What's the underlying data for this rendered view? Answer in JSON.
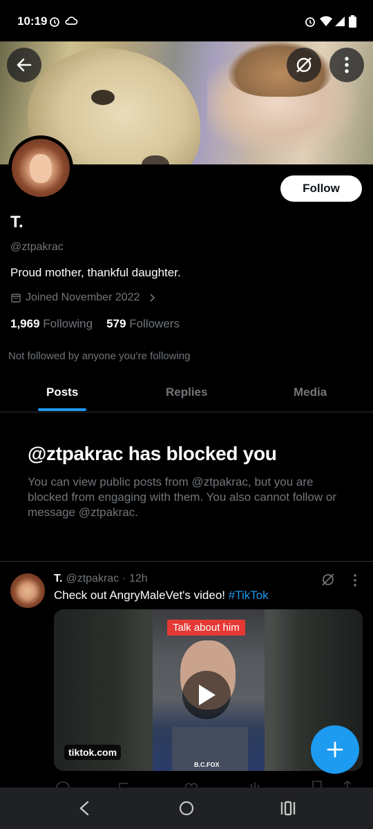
{
  "status_bar": {
    "time": "10:19",
    "icons": [
      "alarm-icon",
      "cloud-icon",
      "alarm-icon",
      "wifi-icon",
      "signal-icon",
      "battery-icon"
    ]
  },
  "header": {
    "back_icon": "arrow-left-icon",
    "grok_icon": "grok-icon",
    "more_icon": "more-vertical-icon"
  },
  "profile": {
    "follow_label": "Follow",
    "name": "T.",
    "handle": "@ztpakrac",
    "bio": "Proud mother, thankful daughter.",
    "joined": "Joined November 2022",
    "following_count": "1,969",
    "following_label": "Following",
    "followers_count": "579",
    "followers_label": "Followers",
    "not_followed": "Not followed by anyone you’re following"
  },
  "tabs": [
    {
      "label": "Posts",
      "active": true
    },
    {
      "label": "Replies",
      "active": false
    },
    {
      "label": "Media",
      "active": false
    }
  ],
  "blocked": {
    "title": "@ztpakrac has blocked you",
    "text": "You can view public posts from @ztpakrac, but you are blocked from engaging with them. You also cannot follow or message @ztpakrac."
  },
  "post": {
    "name": "T.",
    "handle": "@ztpakrac",
    "time": "· 12h",
    "text": "Check out AngryMaleVet's video!",
    "hashtag": "#TikTok",
    "card": {
      "overlay_label": "Talk about him",
      "domain": "tiktok.com",
      "watermark": "B.C.FOX"
    }
  },
  "colors": {
    "accent": "#1d9bf0",
    "background": "#000000",
    "muted": "#71767b"
  }
}
